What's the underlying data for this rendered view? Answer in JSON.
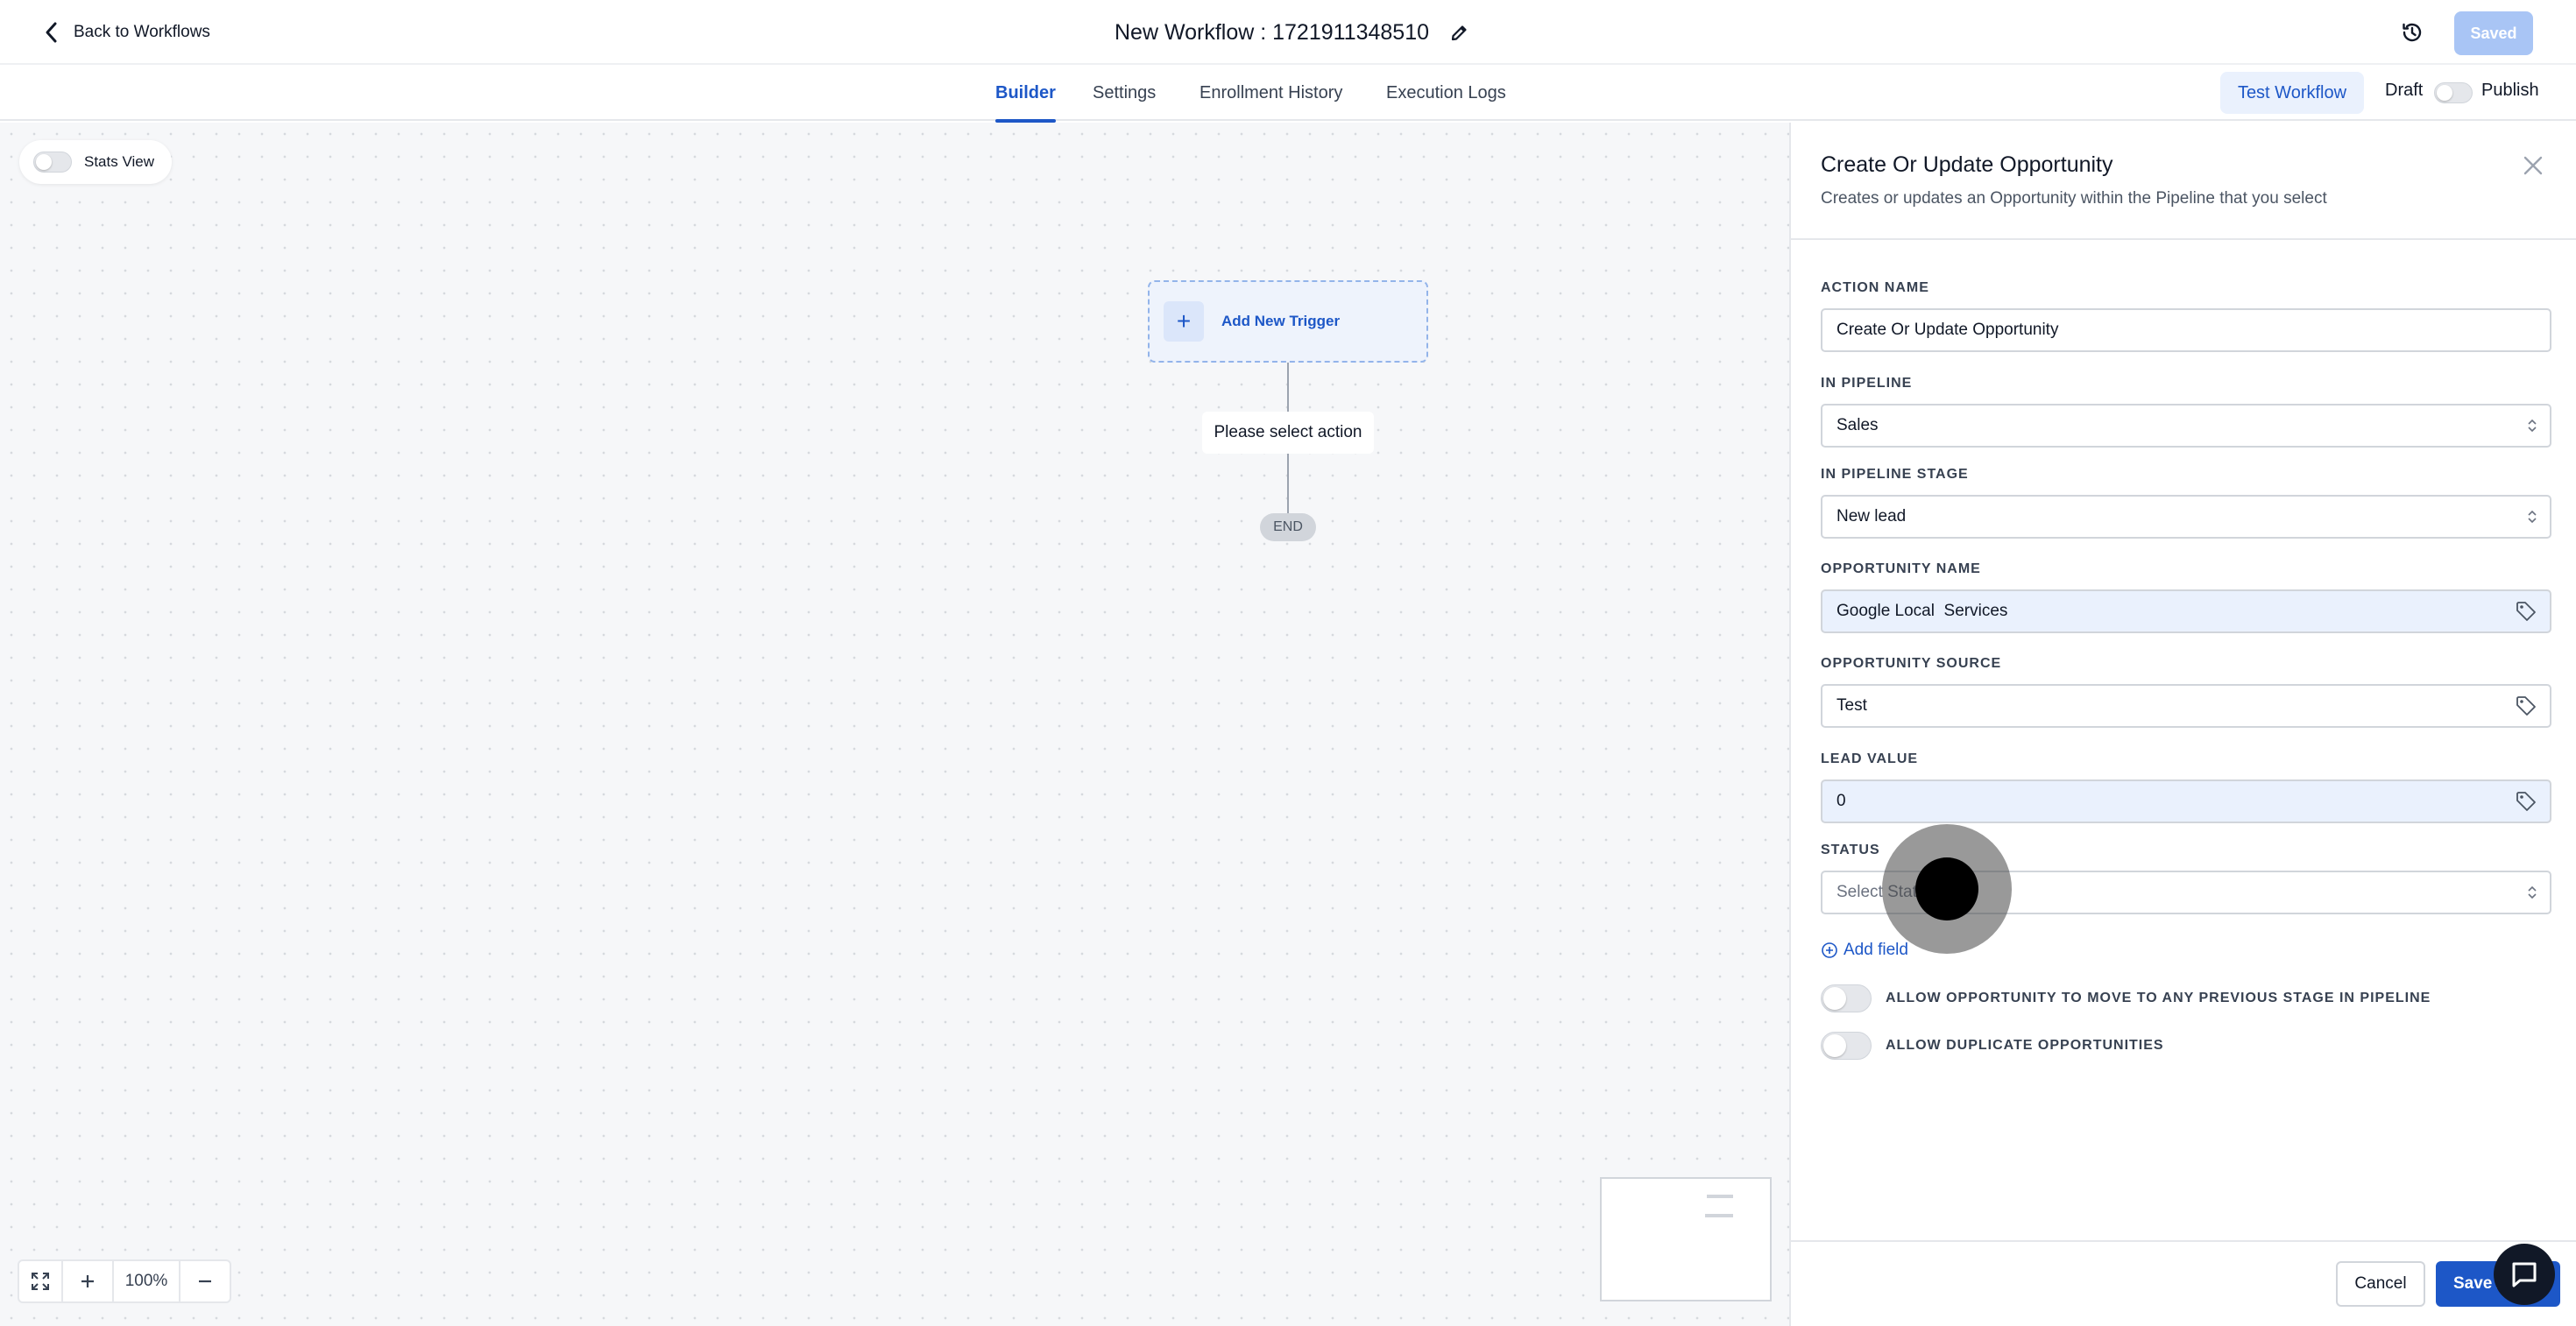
{
  "header": {
    "back_label": "Back to Workflows",
    "workflow_title": "New Workflow : 1721911348510",
    "saved_label": "Saved"
  },
  "tabs": [
    {
      "label": "Builder",
      "active": true
    },
    {
      "label": "Settings",
      "active": false
    },
    {
      "label": "Enrollment History",
      "active": false
    },
    {
      "label": "Execution Logs",
      "active": false
    }
  ],
  "toolbar": {
    "test_workflow_label": "Test Workflow",
    "draft_label": "Draft",
    "publish_label": "Publish",
    "publish_enabled": false
  },
  "canvas": {
    "stats_view_label": "Stats View",
    "stats_view_enabled": false,
    "add_trigger_label": "Add New Trigger",
    "action_placeholder": "Please select action",
    "end_label": "END",
    "zoom_level": "100%"
  },
  "panel": {
    "title": "Create Or Update Opportunity",
    "subtitle": "Creates or updates an Opportunity within the Pipeline that you select",
    "fields": {
      "action_name": {
        "label": "ACTION NAME",
        "value": "Create Or Update Opportunity"
      },
      "pipeline": {
        "label": "IN PIPELINE",
        "value": "Sales"
      },
      "pipeline_stage": {
        "label": "IN PIPELINE STAGE",
        "value": "New lead"
      },
      "opportunity_name": {
        "label": "OPPORTUNITY NAME",
        "value": "Google Local  Services"
      },
      "opportunity_source": {
        "label": "OPPORTUNITY SOURCE",
        "value": "Test"
      },
      "lead_value": {
        "label": "LEAD VALUE",
        "value": "0"
      },
      "status": {
        "label": "STATUS",
        "placeholder": "Select Stat"
      }
    },
    "add_field_label": "Add field",
    "toggles": {
      "allow_previous_stage": {
        "label": "ALLOW OPPORTUNITY TO MOVE TO ANY PREVIOUS STAGE IN PIPELINE",
        "enabled": false
      },
      "allow_duplicates": {
        "label": "ALLOW DUPLICATE OPPORTUNITIES",
        "enabled": false
      }
    },
    "cancel_label": "Cancel",
    "save_label": "Save A"
  },
  "colors": {
    "accent": "#1d57c7",
    "saved_button": "#a9c5f5",
    "tinted_input": "#eaf1fd",
    "canvas_bg": "#f6f7f9"
  },
  "icons": [
    "chevron-left-icon",
    "pencil-icon",
    "history-icon",
    "plus-icon",
    "close-icon",
    "tag-icon",
    "sort-arrows-icon",
    "plus-circle-icon",
    "fullscreen-icon",
    "minus-icon",
    "chat-icon"
  ]
}
